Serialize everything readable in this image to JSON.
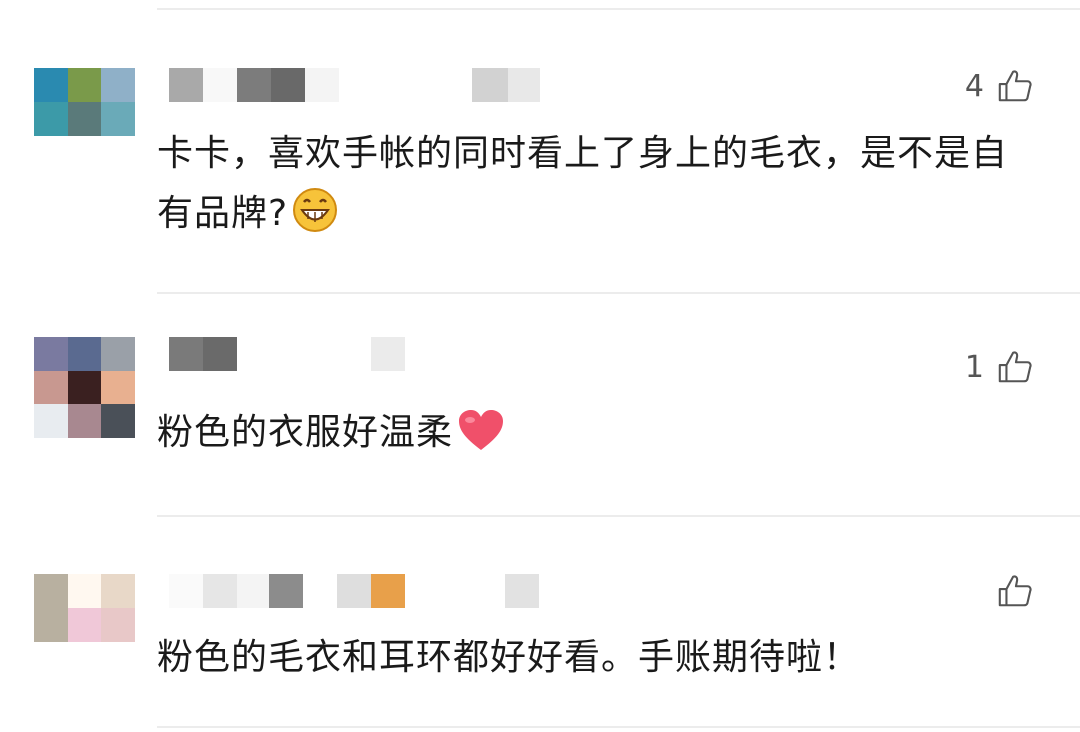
{
  "comments": [
    {
      "text": "卡卡，喜欢手帐的同时看上了身上的毛衣，是不是自有品牌?",
      "like_count": "4",
      "emoji": "grinning-face-emoji",
      "avatar_colors": [
        "#2a8ab0",
        "#7a9a4a",
        "#8fb0c8",
        "#3c9aa8",
        "#5a7a7a",
        "#6aaab8"
      ],
      "name_mosaic_colors": [
        "#a9a9a9",
        "#f8f8f8",
        "#7c7c7c",
        "#696969",
        "#f4f4f4",
        "#d2d2d2",
        "#e8e8e8"
      ]
    },
    {
      "text": "粉色的衣服好温柔",
      "like_count": "1",
      "emoji": "red-heart-emoji",
      "avatar_colors": [
        "#7a7aa0",
        "#5a6a90",
        "#9aa0a8",
        "#c89890",
        "#3a2020",
        "#e8b090",
        "#e8ecf0",
        "#a88890",
        "#4a5058"
      ],
      "name_mosaic_colors": [
        "#7a7a7a",
        "#6a6a6a",
        "#ebebeb"
      ]
    },
    {
      "text": "粉色的毛衣和耳环都好好看。手账期待啦！",
      "like_count": "",
      "avatar_colors": [
        "#b8b0a0",
        "#fff8f0",
        "#e8d8c8",
        "#b8b0a0",
        "#f0c8d8",
        "#e8c8c8"
      ],
      "name_mosaic_colors": [
        "#fafafa",
        "#e6e6e6",
        "#f4f4f4",
        "#8c8c8c",
        "#dedede",
        "#e8a04a",
        "#e2e2e2"
      ]
    }
  ],
  "colors": {
    "text": "#1a1a1a",
    "like_icon": "#555555",
    "divider": "#ececec",
    "heart": "#f0506a",
    "emoji_face": "#f7c33a"
  }
}
